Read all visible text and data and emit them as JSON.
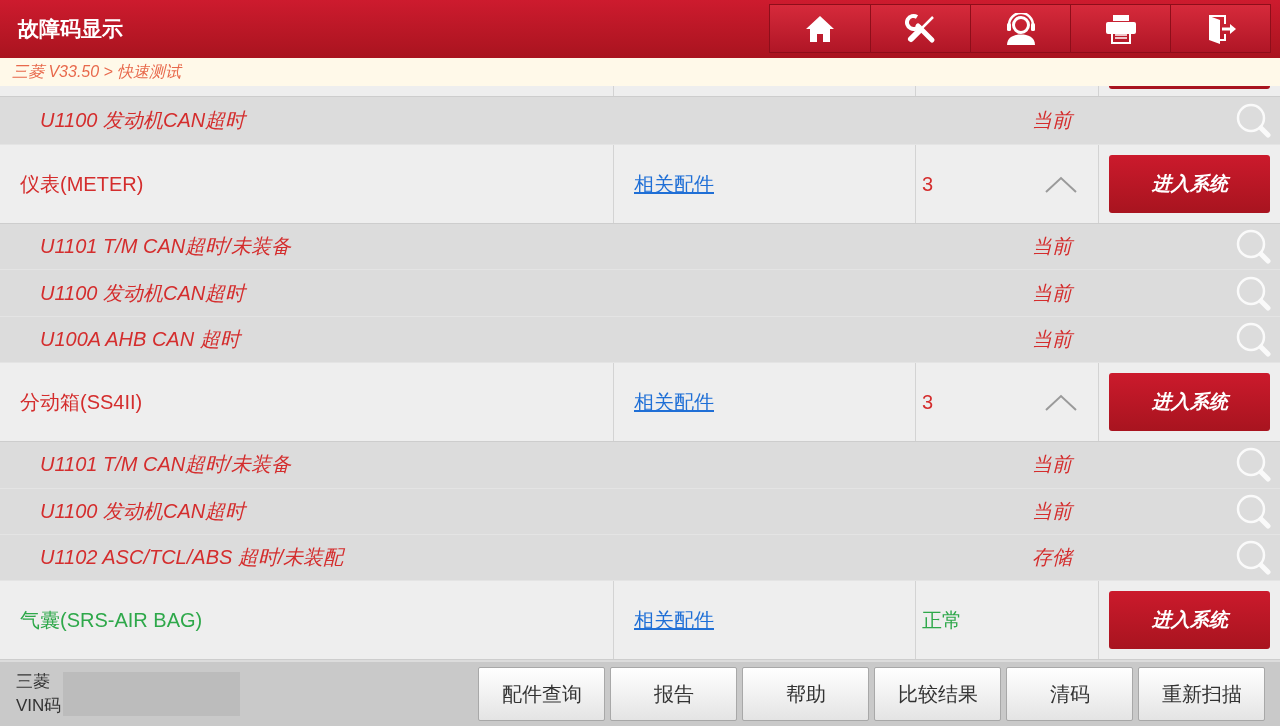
{
  "header": {
    "title": "故障码显示"
  },
  "breadcrumb": "三菱 V33.50 > 快速测试",
  "systems": [
    {
      "cut_off": true,
      "children": [
        {
          "code": "U1100 发动机CAN超时",
          "state": "当前"
        }
      ]
    },
    {
      "cut_off": false,
      "name": "仪表(METER)",
      "color": "#d42d2d",
      "link": "相关配件",
      "result": "3",
      "expanded": true,
      "button": "进入系统",
      "children": [
        {
          "code": "U1101 T/M CAN超时/未装备",
          "state": "当前"
        },
        {
          "code": "U1100 发动机CAN超时",
          "state": "当前"
        },
        {
          "code": "U100A AHB CAN 超时",
          "state": "当前"
        }
      ]
    },
    {
      "cut_off": false,
      "name": "分动箱(SS4II)",
      "color": "#d42d2d",
      "link": "相关配件",
      "result": "3",
      "expanded": true,
      "button": "进入系统",
      "children": [
        {
          "code": "U1101 T/M CAN超时/未装备",
          "state": "当前"
        },
        {
          "code": "U1100 发动机CAN超时",
          "state": "当前"
        },
        {
          "code": "U1102 ASC/TCL/ABS 超时/未装配",
          "state": "存储"
        }
      ]
    },
    {
      "cut_off": false,
      "name": "气囊(SRS-AIR BAG)",
      "color": "#2ea84a",
      "link": "相关配件",
      "result": "正常",
      "button": "进入系统"
    }
  ],
  "footer": {
    "make": "三菱",
    "vin_label": "VIN码",
    "buttons": [
      "配件查询",
      "报告",
      "帮助",
      "比较结果",
      "清码",
      "重新扫描"
    ]
  }
}
